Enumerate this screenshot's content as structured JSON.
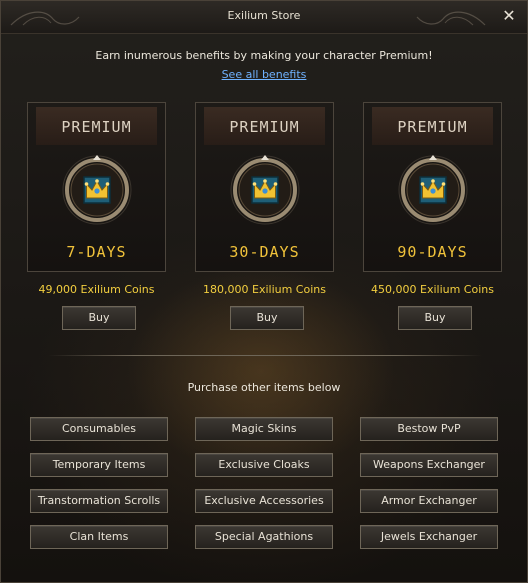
{
  "window": {
    "title": "Exilium Store"
  },
  "intro": {
    "text": "Earn inumerous benefits by making your character Premium!",
    "link": "See all benefits"
  },
  "plans": [
    {
      "header": "PREMIUM",
      "duration": "7-DAYS",
      "price": "49,000 Exilium Coins",
      "buy": "Buy"
    },
    {
      "header": "PREMIUM",
      "duration": "30-DAYS",
      "price": "180,000 Exilium Coins",
      "buy": "Buy"
    },
    {
      "header": "PREMIUM",
      "duration": "90-DAYS",
      "price": "450,000 Exilium Coins",
      "buy": "Buy"
    }
  ],
  "other": {
    "label": "Purchase other items below",
    "items": [
      "Consumables",
      "Magic Skins",
      "Bestow PvP",
      "Temporary Items",
      "Exclusive Cloaks",
      "Weapons Exchanger",
      "Transtormation Scrolls",
      "Exclusive Accessories",
      "Armor Exchanger",
      "Clan Items",
      "Special Agathions",
      "Jewels Exchanger"
    ]
  },
  "colors": {
    "accent_gold": "#f0c23a",
    "price_gold": "#f2ce3f",
    "link": "#6fb2ff",
    "icon_frame": "#1f5f77"
  },
  "icons": {
    "close": "close-icon",
    "premium": "crown-icon"
  }
}
